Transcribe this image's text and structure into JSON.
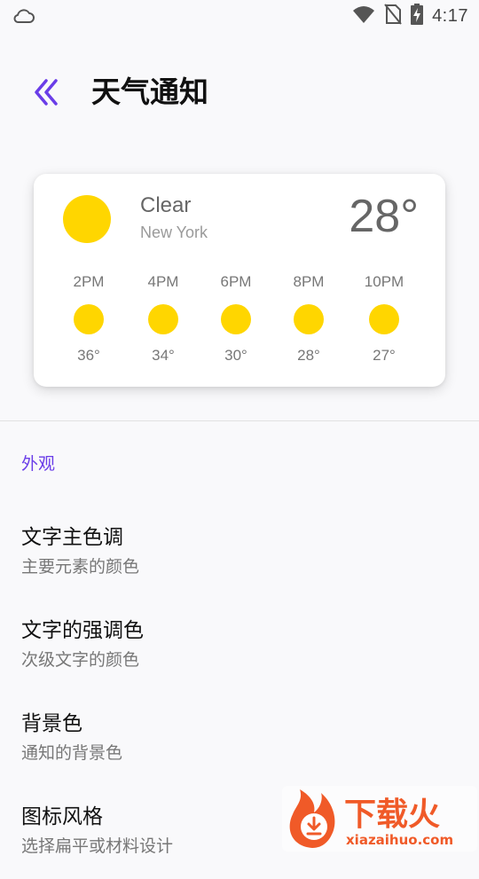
{
  "status_bar": {
    "time": "4:17",
    "left_icon": "cloud-icon",
    "right_icons": [
      "wifi-icon",
      "no-sim-icon",
      "battery-charging-icon"
    ]
  },
  "header": {
    "title": "天气通知",
    "back_icon": "double-chevron-left-icon"
  },
  "weather_card": {
    "condition": "Clear",
    "location": "New York",
    "current_temp": "28°",
    "icon": "sun-icon",
    "hourly": [
      {
        "time": "2PM",
        "temp": "36°",
        "icon": "sun-icon"
      },
      {
        "time": "4PM",
        "temp": "34°",
        "icon": "sun-icon"
      },
      {
        "time": "6PM",
        "temp": "30°",
        "icon": "sun-icon"
      },
      {
        "time": "8PM",
        "temp": "28°",
        "icon": "sun-icon"
      },
      {
        "time": "10PM",
        "temp": "27°",
        "icon": "sun-icon"
      }
    ]
  },
  "section": {
    "title": "外观"
  },
  "settings": [
    {
      "title": "文字主色调",
      "subtitle": "主要元素的颜色"
    },
    {
      "title": "文字的强调色",
      "subtitle": "次级文字的颜色"
    },
    {
      "title": "背景色",
      "subtitle": "通知的背景色"
    },
    {
      "title": "图标风格",
      "subtitle": "选择扁平或材料设计"
    }
  ],
  "watermark": {
    "brand": "下载火",
    "url": "xiazaihuo.com"
  },
  "colors": {
    "accent": "#6a3de8",
    "sun": "#ffd600",
    "background": "#f9f9fb",
    "card": "#ffffff",
    "watermark": "#f05a28"
  }
}
